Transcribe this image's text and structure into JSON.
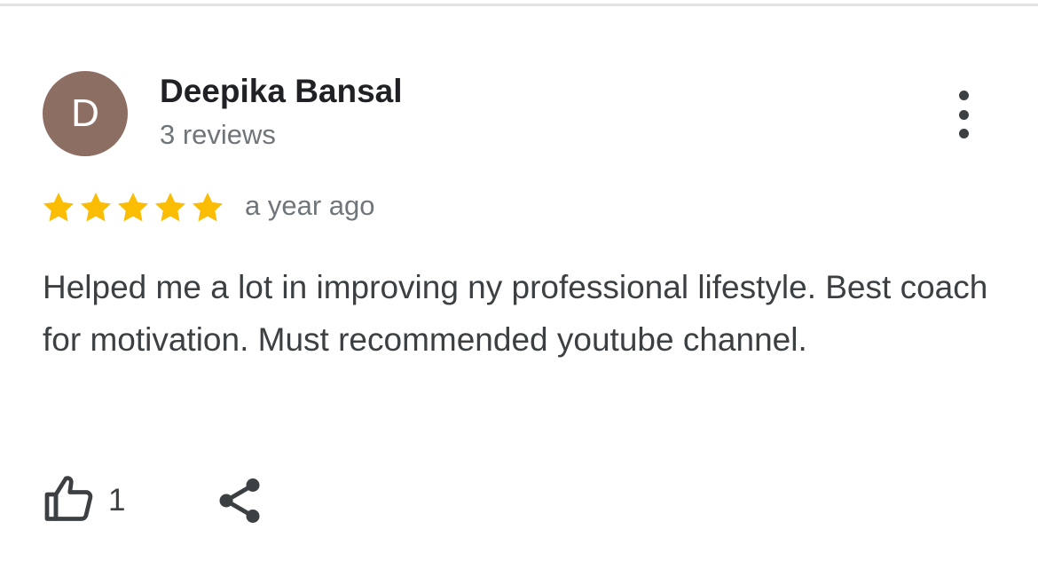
{
  "review": {
    "avatar_initial": "D",
    "avatar_color": "#8d6e63",
    "author_name": "Deepika Bansal",
    "review_count": "3 reviews",
    "rating": 5,
    "rating_max": 5,
    "star_color": "#fbbc04",
    "time": "a year ago",
    "text": "Helped me a lot in improving ny professional lifestyle. Best coach for motivation. Must recommended youtube channel.",
    "like_count": "1"
  },
  "icons": {
    "more": "more-vert-icon",
    "like": "thumbs-up-icon",
    "share": "share-icon",
    "star": "star-icon"
  }
}
